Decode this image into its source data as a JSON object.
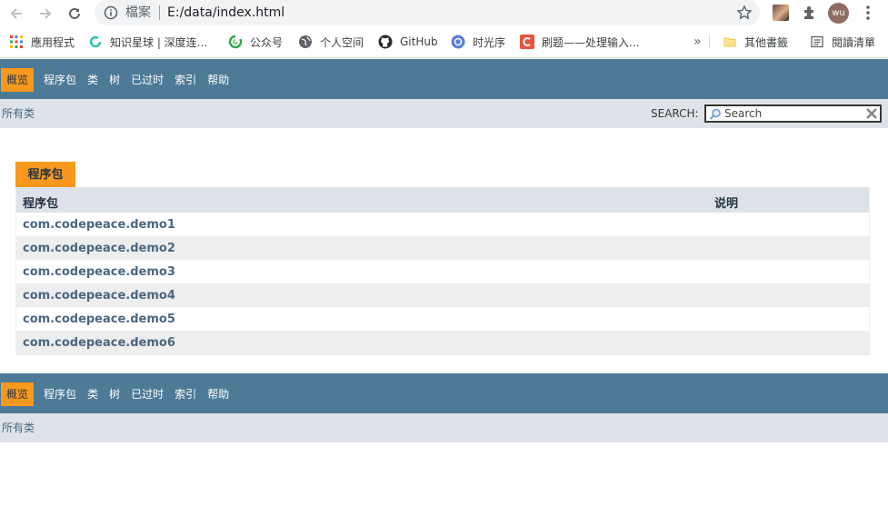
{
  "browser": {
    "security_label": "檔案",
    "url": "E:/data/index.html",
    "profile_initials": "wu"
  },
  "bookmarks": {
    "items": [
      {
        "label": "應用程式",
        "icon": "apps-grid-icon"
      },
      {
        "label": "知识星球 | 深度连...",
        "icon": "zsxq-icon"
      },
      {
        "label": "公众号",
        "icon": "wechat-icon"
      },
      {
        "label": "个人空间",
        "icon": "globe-icon"
      },
      {
        "label": "GitHub",
        "icon": "github-icon"
      },
      {
        "label": "时光序",
        "icon": "shiguangxu-icon"
      },
      {
        "label": "刷题——处理输入...",
        "icon": "csdn-icon"
      }
    ],
    "overflow": "»",
    "other_bookmarks": "其他書籤",
    "reading_list": "閱讀清單"
  },
  "nav": {
    "items": [
      "概览",
      "程序包",
      "类",
      "树",
      "已过时",
      "索引",
      "帮助"
    ],
    "all_classes": "所有类"
  },
  "search": {
    "label": "SEARCH:",
    "placeholder": "Search"
  },
  "packages": {
    "caption": "程序包",
    "col_package": "程序包",
    "col_description": "说明",
    "rows": [
      "com.codepeace.demo1",
      "com.codepeace.demo2",
      "com.codepeace.demo3",
      "com.codepeace.demo4",
      "com.codepeace.demo5",
      "com.codepeace.demo6"
    ]
  },
  "colors": {
    "nav_bar": "#4d7a97",
    "nav_active": "#f8981d",
    "subnav": "#dee3e9",
    "link": "#4a6782",
    "row_alt": "#eeeeef"
  }
}
